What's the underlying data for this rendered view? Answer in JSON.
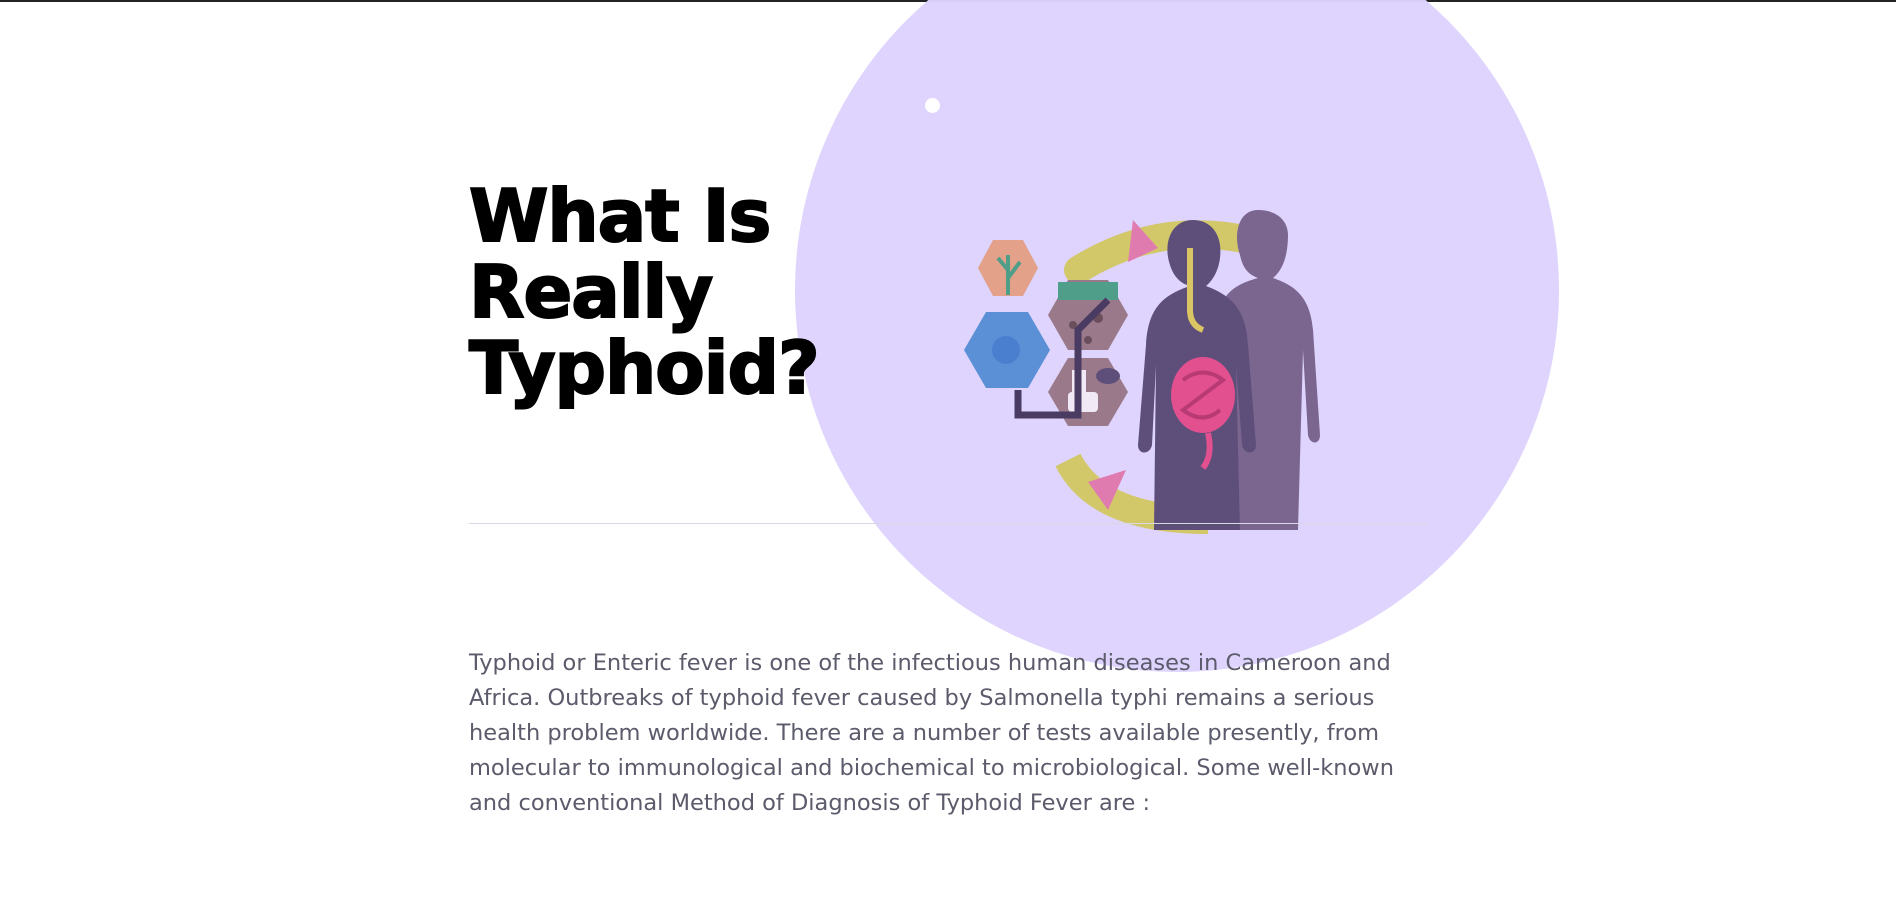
{
  "hero": {
    "title_line1": "What Is",
    "title_line2": "Really",
    "title_line3": "Typhoid?"
  },
  "intro": {
    "paragraph": "Typhoid or Enteric fever is one of the infectious human diseases in Cameroon and Africa. Outbreaks of typhoid fever caused by Salmonella typhi remains a serious health problem worldwide. There are a number of tests available presently, from molecular to immunological and biochemical to microbiological. Some well-known and conventional Method of Diagnosis of Typhoid Fever are :"
  },
  "illustration": {
    "icon": "typhoid-transmission-cycle-illustration"
  },
  "colors": {
    "accent_circle": "#ddd3fd",
    "heading": "#000000",
    "body_text": "#5b5b6b",
    "figure_front": "#5e4f7a",
    "figure_back": "#7b6690",
    "intestine": "#e2508f",
    "cycle_arrow": "#d2c86a"
  }
}
